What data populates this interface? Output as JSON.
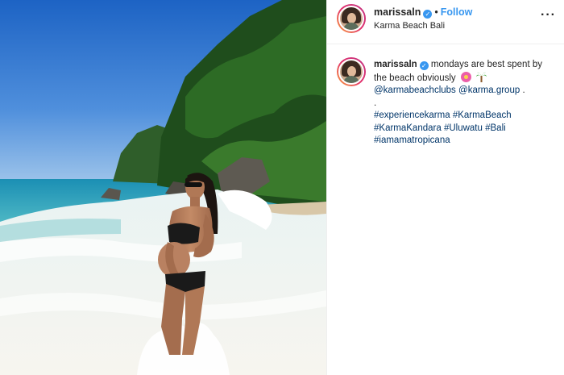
{
  "post": {
    "username": "marissaln",
    "verified_icon": "verified-badge-icon",
    "follow_label": "Follow",
    "dot": "•",
    "location": "Karma Beach Bali",
    "more_icon": "more-options-icon",
    "more_glyph": "···"
  },
  "caption": {
    "username": "marissaln",
    "text": "mondays are best spent by the beach obviously",
    "emojis": [
      "hibiscus-emoji",
      "palm-tree-emoji"
    ],
    "mentions": [
      "@karmabeachclubs",
      "@karma.group"
    ],
    "separator_1": ".",
    "separator_2": ".",
    "hashtags": [
      "#experiencekarma",
      "#KarmaBeach",
      "#KarmaKandara",
      "#Uluwatu",
      "#Bali",
      "#iamamatropicana"
    ]
  },
  "photo": {
    "description_icon": "beach-photo"
  },
  "colors": {
    "link": "#003569",
    "follow": "#3897f0",
    "verified": "#3897f0"
  }
}
